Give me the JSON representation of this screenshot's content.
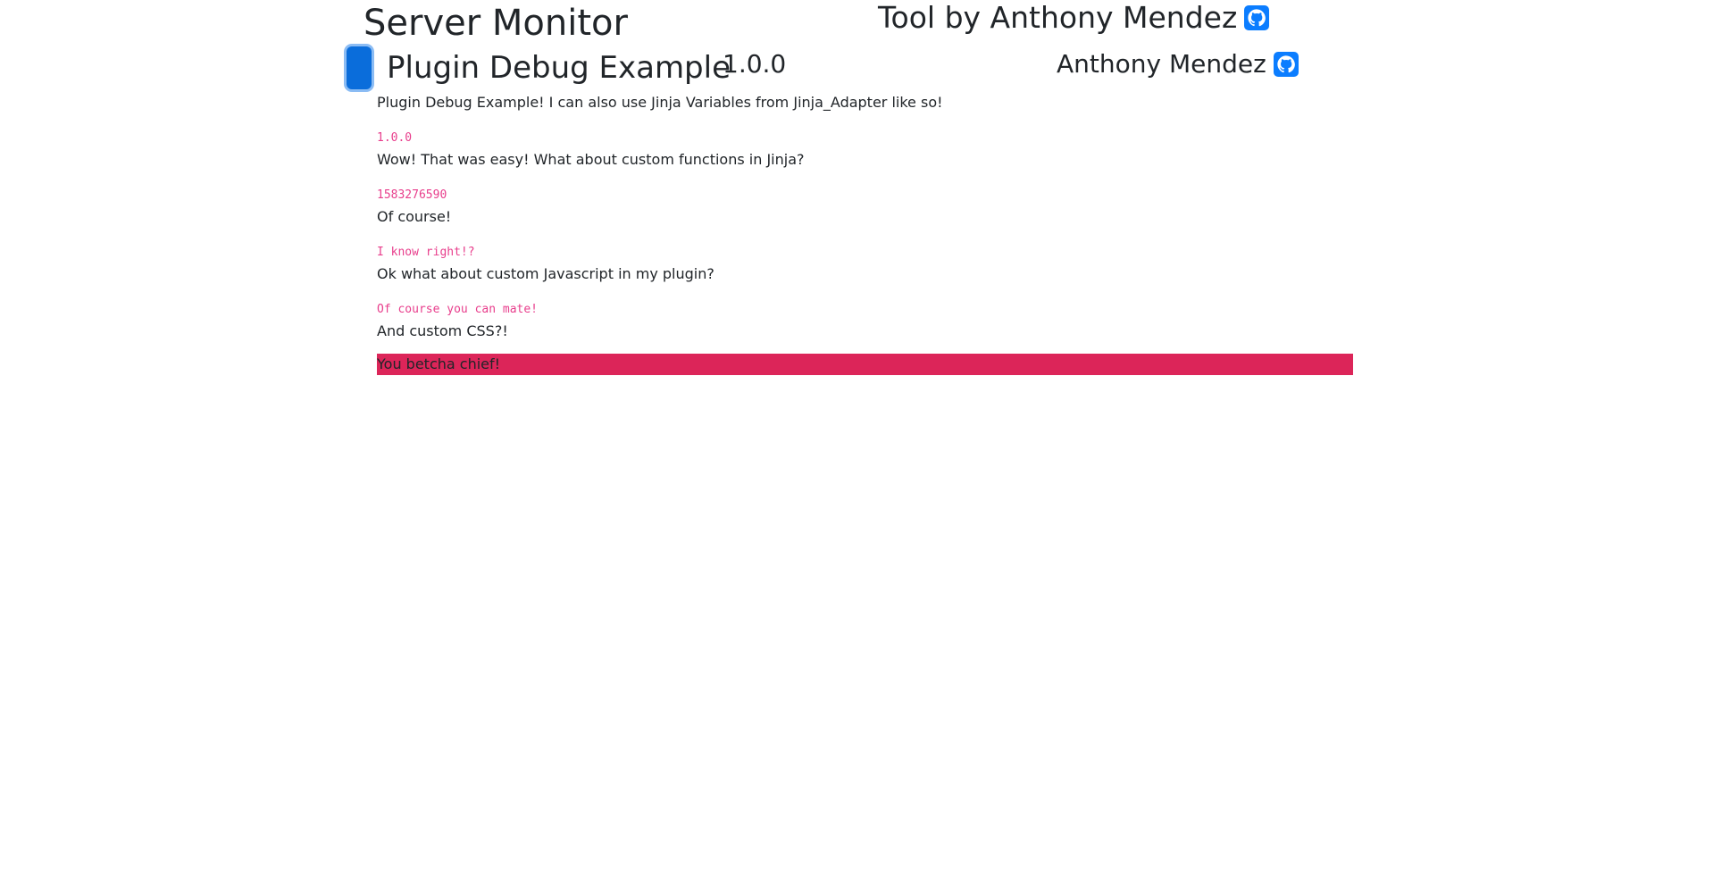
{
  "header": {
    "title": "Server Monitor",
    "author_text": "Tool by Anthony Mendez",
    "author_icon": "github-icon"
  },
  "plugin": {
    "name": "Plugin Debug Example",
    "version": "1.0.0",
    "author": "Anthony Mendez",
    "author_icon": "github-icon",
    "toggle_color": "#0a6ddb"
  },
  "content": {
    "intro": "Plugin Debug Example! I can also use Jinja Variables from Jinja_Adapter like so!",
    "code_1": "1.0.0",
    "line_2": "Wow! That was easy! What about custom functions in Jinja?",
    "code_2": "1583276590",
    "line_3": "Of course!",
    "code_3": "I know right!?",
    "line_4": "Ok what about custom Javascript in my plugin?",
    "code_4": "Of course you can mate!",
    "line_5": "And custom CSS?!",
    "highlight": "You betcha chief!",
    "highlight_color": "#dc2559",
    "code_color": "#e83e8c"
  }
}
